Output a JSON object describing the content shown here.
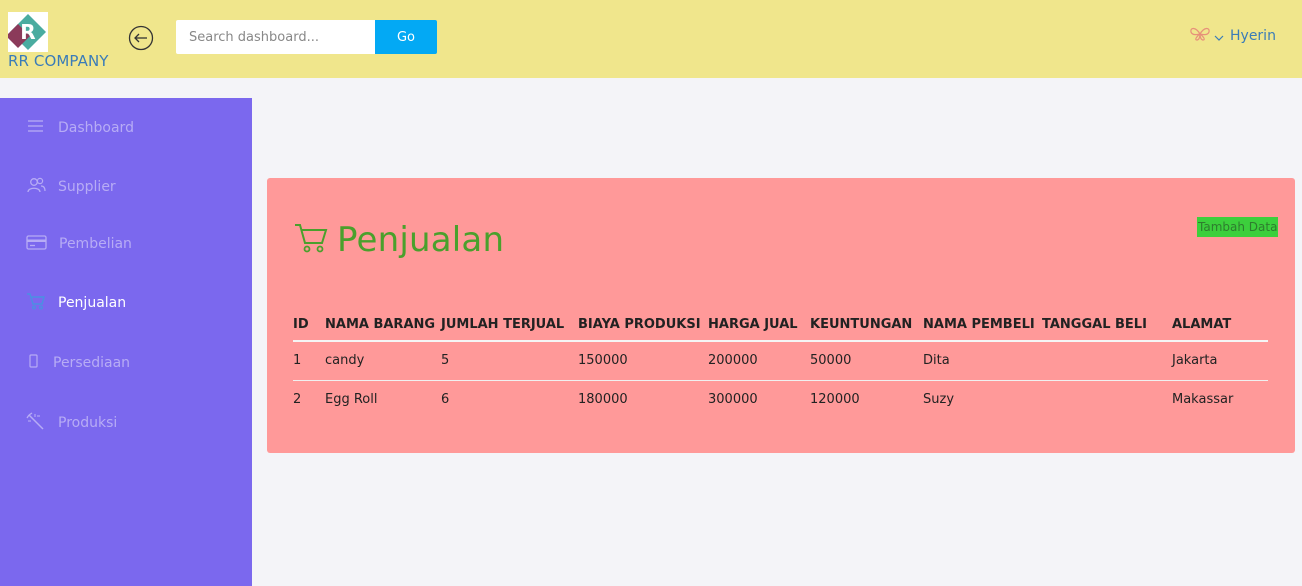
{
  "header": {
    "brand": "RR COMPANY",
    "logo_text": "R",
    "search_placeholder": "Search dashboard...",
    "go_label": "Go",
    "user_name": "Hyerin"
  },
  "sidebar": {
    "items": [
      {
        "label": "Dashboard",
        "icon": "menu-icon",
        "active": false
      },
      {
        "label": "Supplier",
        "icon": "users-icon",
        "active": false
      },
      {
        "label": "Pembelian",
        "icon": "credit-card-icon",
        "active": false
      },
      {
        "label": "Penjualan",
        "icon": "cart-icon",
        "active": true
      },
      {
        "label": "Persediaan",
        "icon": "box-icon",
        "active": false
      },
      {
        "label": "Produksi",
        "icon": "tools-icon",
        "active": false
      }
    ]
  },
  "main": {
    "title": "Penjualan",
    "add_label": "Tambah Data",
    "columns": [
      "ID",
      "NAMA BARANG",
      "JUMLAH TERJUAL",
      "BIAYA PRODUKSI",
      "HARGA JUAL",
      "KEUNTUNGAN",
      "NAMA PEMBELI",
      "TANGGAL BELI",
      "ALAMAT"
    ],
    "rows": [
      [
        "1",
        "candy",
        "5",
        "150000",
        "200000",
        "50000",
        "Dita",
        "",
        "Jakarta"
      ],
      [
        "2",
        "Egg Roll",
        "6",
        "180000",
        "300000",
        "120000",
        "Suzy",
        "",
        "Makassar"
      ]
    ]
  },
  "colors": {
    "header_bg": "#f0e68c",
    "sidebar_bg": "#7b68ee",
    "card_bg": "#ff9999",
    "title_green": "#4aa02c",
    "go_button": "#03a9f4",
    "add_button": "#3ccf3c"
  }
}
